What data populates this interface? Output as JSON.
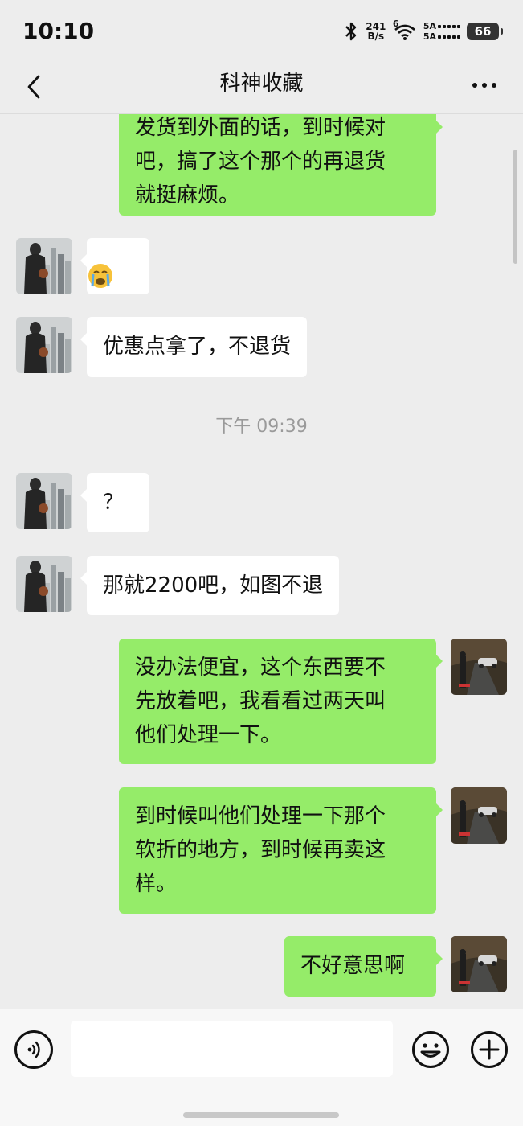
{
  "status_bar": {
    "time": "10:10",
    "net_speed_value": "241",
    "net_speed_unit": "B/s",
    "wifi_label": "6",
    "sim1_label": "5A",
    "sim2_label": "5A",
    "battery_level": "66"
  },
  "header": {
    "title": "科神收藏",
    "back_icon": "chevron-left-icon",
    "more_icon": "more-dots-icon"
  },
  "messages": [
    {
      "side": "right",
      "text": "发货到外面的话，到时候对\n吧，搞了这个那个的再退货\n就挺麻烦。"
    },
    {
      "side": "left",
      "text": "😭",
      "emoji_name": "crying-face-emoji"
    },
    {
      "side": "left",
      "text": "优惠点拿了，不退货"
    },
    {
      "type": "time",
      "text": "下午 09:39"
    },
    {
      "side": "left",
      "text": "？"
    },
    {
      "side": "left",
      "text": "那就2200吧，如图不退"
    },
    {
      "side": "right",
      "text": "没办法便宜，这个东西要不\n先放着吧，我看看过两天叫\n他们处理一下。"
    },
    {
      "side": "right",
      "text": "到时候叫他们处理一下那个\n软折的地方，到时候再卖这\n样。"
    },
    {
      "side": "right",
      "text": "不好意思啊"
    }
  ],
  "input_bar": {
    "voice_icon": "voice-icon",
    "text_value": "",
    "emoji_icon": "emoji-icon",
    "plus_icon": "plus-icon"
  },
  "colors": {
    "background": "#ededed",
    "self_bubble": "#95ec69",
    "other_bubble": "#ffffff",
    "timestamp": "#9a9a9a"
  }
}
